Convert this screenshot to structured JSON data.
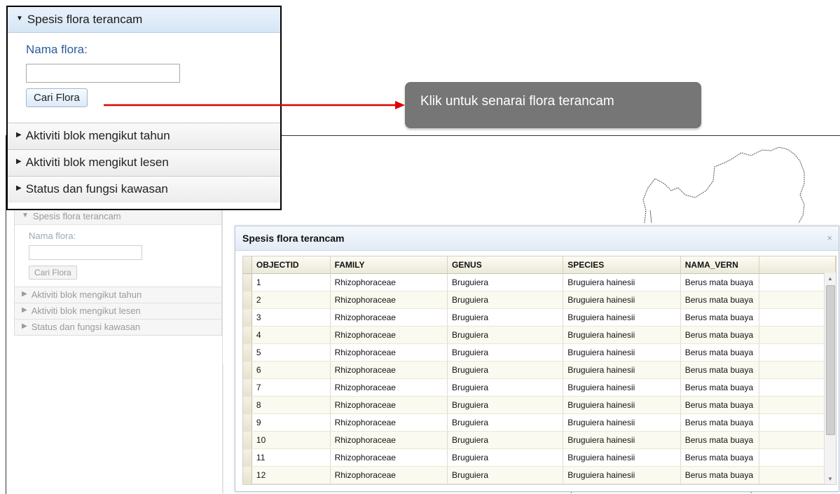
{
  "zoomed_panel": {
    "accordion": {
      "expanded_header": "Spesis flora terancam",
      "label": "Nama flora:",
      "input_value": "",
      "button": "Cari Flora",
      "items": [
        "Aktiviti blok mengikut tahun",
        "Aktiviti blok mengikut lesen",
        "Status dan fungsi kawasan"
      ]
    }
  },
  "tooltip": {
    "text": "Klik untuk senarai flora terancam",
    "arrow_color": "#e00000"
  },
  "background_panel": {
    "accordion": {
      "expanded_header": "Spesis flora terancam",
      "label": "Nama flora:",
      "input_value": "",
      "button": "Cari Flora",
      "items": [
        "Aktiviti blok mengikut tahun",
        "Aktiviti blok mengikut lesen",
        "Status dan fungsi kawasan"
      ]
    }
  },
  "dialog": {
    "title": "Spesis flora terancam",
    "close_glyph": "×",
    "columns": [
      "OBJECTID",
      "FAMILY",
      "GENUS",
      "SPECIES",
      "NAMA_VERN"
    ],
    "rows": [
      [
        "1",
        "Rhizophoraceae",
        "Bruguiera",
        "Bruguiera hainesii",
        "Berus mata buaya"
      ],
      [
        "2",
        "Rhizophoraceae",
        "Bruguiera",
        "Bruguiera hainesii",
        "Berus mata buaya"
      ],
      [
        "3",
        "Rhizophoraceae",
        "Bruguiera",
        "Bruguiera hainesii",
        "Berus mata buaya"
      ],
      [
        "4",
        "Rhizophoraceae",
        "Bruguiera",
        "Bruguiera hainesii",
        "Berus mata buaya"
      ],
      [
        "5",
        "Rhizophoraceae",
        "Bruguiera",
        "Bruguiera hainesii",
        "Berus mata buaya"
      ],
      [
        "6",
        "Rhizophoraceae",
        "Bruguiera",
        "Bruguiera hainesii",
        "Berus mata buaya"
      ],
      [
        "7",
        "Rhizophoraceae",
        "Bruguiera",
        "Bruguiera hainesii",
        "Berus mata buaya"
      ],
      [
        "8",
        "Rhizophoraceae",
        "Bruguiera",
        "Bruguiera hainesii",
        "Berus mata buaya"
      ],
      [
        "9",
        "Rhizophoraceae",
        "Bruguiera",
        "Bruguiera hainesii",
        "Berus mata buaya"
      ],
      [
        "10",
        "Rhizophoraceae",
        "Bruguiera",
        "Bruguiera hainesii",
        "Berus mata buaya"
      ],
      [
        "11",
        "Rhizophoraceae",
        "Bruguiera",
        "Bruguiera hainesii",
        "Berus mata buaya"
      ],
      [
        "12",
        "Rhizophoraceae",
        "Bruguiera",
        "Bruguiera hainesii",
        "Berus mata buaya"
      ]
    ]
  },
  "colors": {
    "accent_header": "#d6e6f5",
    "label_blue": "#2a5d9c",
    "tooltip_bg": "#767676",
    "grid_header": "#ece9d8"
  }
}
